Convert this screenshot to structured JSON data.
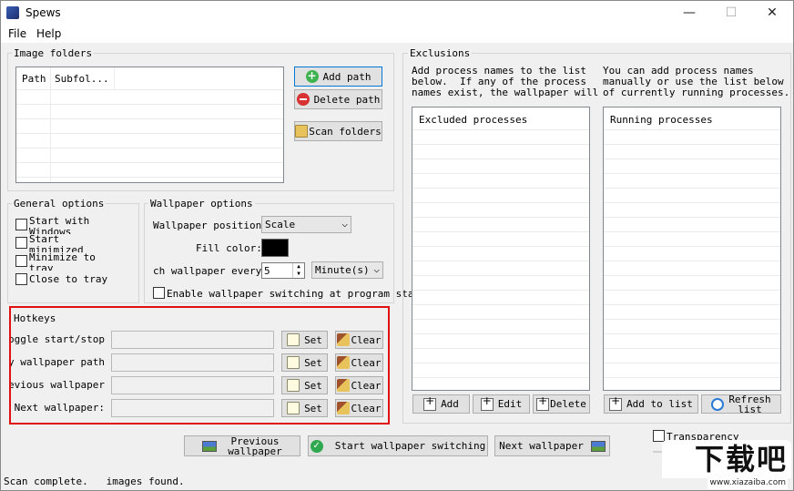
{
  "window": {
    "title": "Spews",
    "minimize": "—",
    "maximize": "☐",
    "close": "✕"
  },
  "menu": {
    "file": "File",
    "help": "Help"
  },
  "image_folders": {
    "label": "Image folders",
    "columns": [
      "Path",
      "Subfol..."
    ],
    "add_path": "Add path",
    "delete_path": "Delete path",
    "scan_folders": "Scan folders"
  },
  "general_options": {
    "label": "General options",
    "start_with_windows": "Start with Windows",
    "start_minimized": "Start minimized",
    "minimize_to_tray": "Minimize to tray",
    "close_to_tray": "Close to tray"
  },
  "wallpaper_options": {
    "label": "Wallpaper options",
    "position_label": "Wallpaper position:",
    "position_value": "Scale",
    "fill_color_label": "Fill color:",
    "fill_color": "#000000",
    "switch_every_label": "ch wallpaper every:",
    "switch_every_value": "5",
    "switch_every_unit": "Minute(s)",
    "enable_switching": "Enable wallpaper switching at program startup"
  },
  "hotkeys": {
    "label": "Hotkeys",
    "set": "Set",
    "clear": "Clear",
    "rows": [
      {
        "label": "oggle start/stop:"
      },
      {
        "label": "y wallpaper path:"
      },
      {
        "label": "evious wallpaper:"
      },
      {
        "label": "Next wallpaper:"
      }
    ]
  },
  "exclusions": {
    "label": "Exclusions",
    "left_desc": "Add process names to the list\nbelow.  If any of the process\nnames exist, the wallpaper will",
    "right_desc": "You can add process names\nmanually or use the list below\nof currently running processes.",
    "excluded_header": "Excluded processes",
    "running_header": "Running processes",
    "add": "Add",
    "edit": "Edit",
    "delete": "Delete",
    "add_to_list": "Add to list",
    "refresh_list": "Refresh\nlist"
  },
  "bottom": {
    "previous": "Previous\nwallpaper",
    "start_switching": "Start wallpaper switching",
    "next": "Next wallpaper",
    "transparency": "Transparency"
  },
  "status": {
    "text": "Scan complete.   images found."
  },
  "watermark": {
    "text": "下载吧",
    "url": "www.xiazaiba.com"
  }
}
